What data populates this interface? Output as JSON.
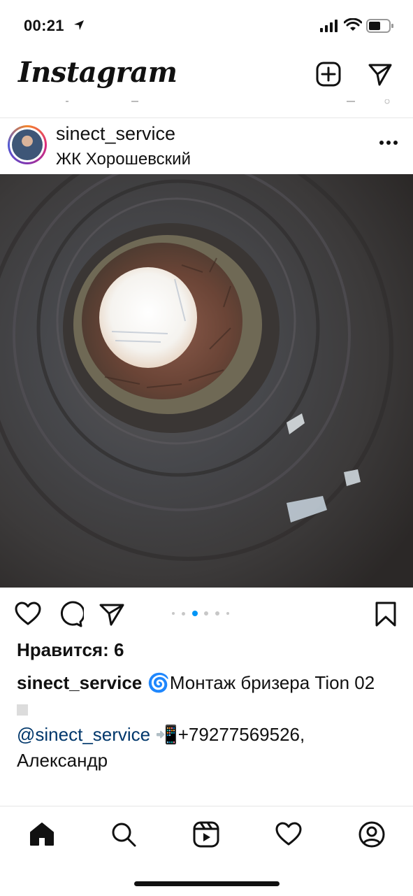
{
  "status_bar": {
    "time": "00:21"
  },
  "header": {
    "logo": "Instagram"
  },
  "post": {
    "username": "sinect_service",
    "location": "ЖК Хорошевский",
    "image_description_icon": "brick-chimney-photo",
    "carousel": {
      "count": 6,
      "active": 2
    },
    "likes_text": "Нравится: 6",
    "caption": {
      "user": "sinect_service",
      "emoji1": "🌀",
      "text1": "Монтаж бризера Tion 02",
      "mention": "@sinect_service",
      "emoji2": "📲",
      "phone_text": "+79277569526, Александр"
    }
  },
  "colors": {
    "accent": "#0095f6",
    "mention": "#00376b",
    "text": "#111111",
    "divider": "#e6e6e6"
  },
  "tabs": [
    "home-icon",
    "search-icon",
    "reels-icon",
    "heart-icon",
    "profile-icon"
  ]
}
